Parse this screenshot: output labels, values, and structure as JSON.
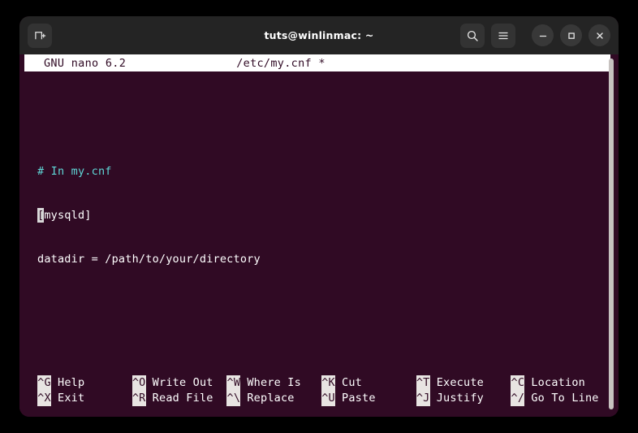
{
  "window": {
    "title": "tuts@winlinmac: ~",
    "background_color": "#300a24",
    "titlebar_color": "#242424",
    "new_tab_label": "new-tab",
    "controls": {
      "search": "search",
      "menu": "menu",
      "minimize": "minimize",
      "maximize": "maximize",
      "close": "close"
    }
  },
  "nano": {
    "version": "GNU nano 6.2",
    "filename": "/etc/my.cnf *",
    "lines": [
      {
        "text": "",
        "style": "plain"
      },
      {
        "text": "",
        "style": "plain"
      },
      {
        "text": "",
        "style": "plain"
      },
      {
        "text": "",
        "style": "plain"
      },
      {
        "text": "# In my.cnf",
        "style": "comment"
      },
      {
        "text": "",
        "style": "plain"
      },
      {
        "text": "[mysqld]",
        "style": "plain",
        "cursor": 0
      },
      {
        "text": "",
        "style": "plain"
      },
      {
        "text": "datadir = /path/to/your/directory",
        "style": "plain"
      }
    ],
    "cursor_line_text_head": "[",
    "cursor_line_text_tail": "mysqld]",
    "comment_color": "#5fd7d7",
    "shortcuts": [
      {
        "key_top": "^G",
        "label_top": "Help",
        "key_bottom": "^X",
        "label_bottom": "Exit"
      },
      {
        "key_top": "^O",
        "label_top": "Write Out",
        "key_bottom": "^R",
        "label_bottom": "Read File"
      },
      {
        "key_top": "^W",
        "label_top": "Where Is",
        "key_bottom": "^\\",
        "label_bottom": "Replace"
      },
      {
        "key_top": "^K",
        "label_top": "Cut",
        "key_bottom": "^U",
        "label_bottom": "Paste"
      },
      {
        "key_top": "^T",
        "label_top": "Execute",
        "key_bottom": "^J",
        "label_bottom": "Justify"
      },
      {
        "key_top": "^C",
        "label_top": "Location",
        "key_bottom": "^/",
        "label_bottom": "Go To Line"
      }
    ]
  }
}
